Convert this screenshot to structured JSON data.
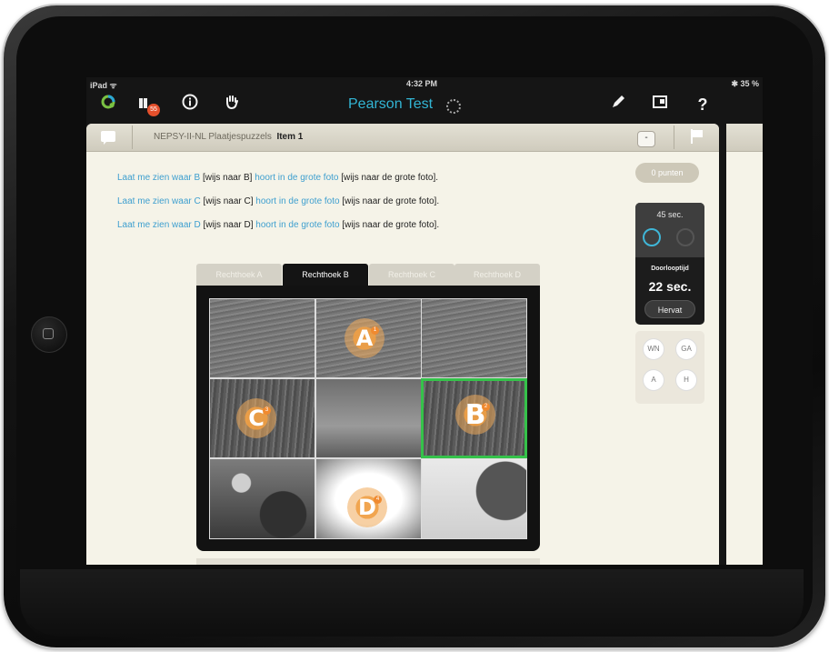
{
  "status_bar": {
    "carrier": "iPad ᯤ",
    "time": "4:32 PM",
    "battery": "✱ 35 %"
  },
  "toolbar": {
    "title": "Pearson Test",
    "badge_count": "55",
    "icons": [
      "q-logo-icon",
      "clients-icon",
      "info-icon",
      "hand-icon",
      "pencil-icon",
      "layout-icon",
      "help-icon"
    ],
    "accent": "#32b5d4"
  },
  "breadcrumb": {
    "test": "NEPSY-II-NL Plaatjespuzzels",
    "item": "Item 1"
  },
  "header_minus": "-",
  "instructions": [
    {
      "a": "Laat me zien waar B",
      "b": " [wijs naar B] ",
      "c": "hoort in de grote foto",
      "d": " [wijs naar de grote foto]."
    },
    {
      "a": "Laat me zien waar C",
      "b": " [wijs naar C] ",
      "c": "hoort in de grote foto",
      "d": " [wijs naar de grote foto]."
    },
    {
      "a": "Laat me zien waar D",
      "b": " [wijs naar D] ",
      "c": "hoort in de grote foto",
      "d": " [wijs naar de grote foto]."
    }
  ],
  "score": "0 punten",
  "timer": {
    "limit": "45 sec.",
    "duration_label": "Doorlooptijd",
    "duration_value": "22 sec.",
    "resume": "Hervat"
  },
  "shortcuts": [
    "WN",
    "GA",
    "A",
    "H"
  ],
  "tabs": [
    "Rechthoek A",
    "Rechthoek B",
    "Rechthoek C",
    "Rechthoek D"
  ],
  "active_tab": "Rechthoek B",
  "markers": [
    {
      "letter": "A",
      "num": "1"
    },
    {
      "letter": "C",
      "num": "3"
    },
    {
      "letter": "B",
      "num": "2"
    },
    {
      "letter": "D",
      "num": "4"
    }
  ],
  "highlight_color": "#35c24a"
}
